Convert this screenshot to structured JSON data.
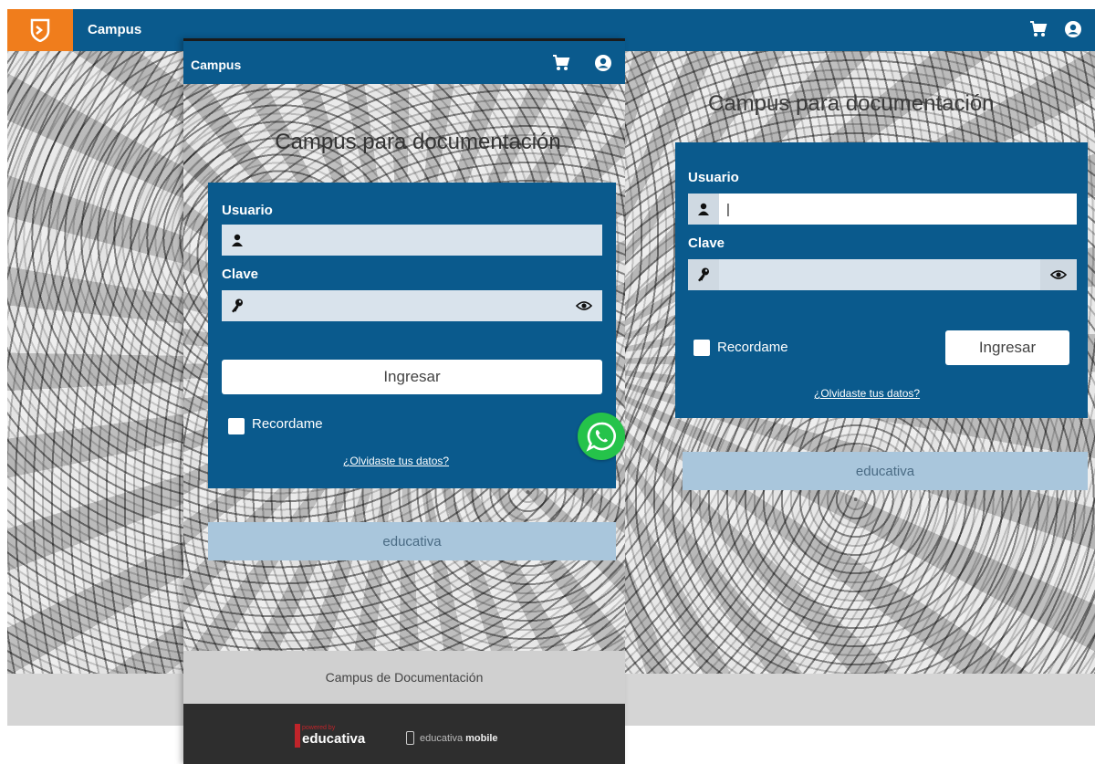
{
  "desktop": {
    "topbar": {
      "title": "Campus",
      "accent": "#0a5a8d",
      "logo_color": "#f07d1c"
    },
    "heading": "Campus para documentación",
    "form": {
      "usuario_label": "Usuario",
      "usuario_value": "|",
      "clave_label": "Clave",
      "recordame_label": "Recordame",
      "ingresar_label": "Ingresar",
      "forgot_label": "¿Olvidaste tus datos?"
    },
    "brand_bar": "educativa"
  },
  "mobile": {
    "topbar": {
      "title": "Campus"
    },
    "heading": "Campus para documentación",
    "form": {
      "usuario_label": "Usuario",
      "clave_label": "Clave",
      "ingresar_label": "Ingresar",
      "recordame_label": "Recordame",
      "forgot_label": "¿Olvidaste tus datos?"
    },
    "brand_bar": "educativa",
    "footer_text": "Campus de Documentación",
    "powered": {
      "small": "powered by",
      "brand": "educativa"
    },
    "mobile_badge": {
      "prefix": "educativa",
      "suffix": "mobile"
    }
  },
  "icons": {
    "cart": "cart-icon",
    "user": "user-circle-icon",
    "person": "person-icon",
    "key": "key-icon",
    "eye": "eye-icon",
    "whatsapp": "whatsapp-icon"
  }
}
